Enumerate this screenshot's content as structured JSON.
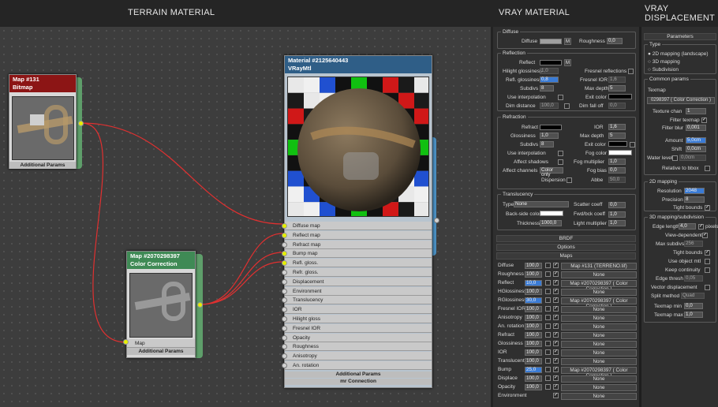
{
  "headers": {
    "terrain": "TERRAIN MATERIAL",
    "vray": "VRAY MATERIAL",
    "disp1": "VRAY",
    "disp2": "DISPLACEMENT"
  },
  "bitmap_node": {
    "title": "Map #131",
    "subtitle": "Bitmap",
    "footer": "Additional Params"
  },
  "cc_node": {
    "title": "Map #2070298397",
    "subtitle": "Color Correction",
    "slot": "Map",
    "footer": "Additional Params"
  },
  "mtl_node": {
    "title": "Material #2125640443",
    "subtitle": "VRayMtl",
    "slots": [
      "Diffuse map",
      "Reflect map",
      "Refract map",
      "Bump map",
      "Refl. gloss.",
      "Refr. gloss.",
      "Displacement",
      "Environment",
      "Translucency",
      "IOR",
      "Hilight gloss",
      "Fresnel IOR",
      "Opacity",
      "Roughness",
      "Anisotropy",
      "An. rotation"
    ],
    "footer1": "Additional Params",
    "footer2": "mr Connection"
  },
  "panel": {
    "diffuse_group": "Diffuse",
    "diffuse": "Diffuse",
    "roughness": "Roughness",
    "roughness_val": "0,0",
    "reflection_group": "Reflection",
    "reflect": "Reflect",
    "hilight": "Hilight glossiness",
    "hilight_val": "1,0",
    "fresnel": "Fresnel reflections",
    "refl_gloss": "Refl. glossiness",
    "refl_gloss_val": "0,8",
    "fresnel_ior": "Fresnel IOR",
    "fresnel_ior_val": "1,6",
    "subdivs": "Subdivs",
    "subdivs_val": "8",
    "max_depth": "Max depth",
    "max_depth_val": "5",
    "use_interp": "Use interpolation",
    "exit_color": "Exit color",
    "dim_dist": "Dim distance",
    "dim_dist_val": "100,0",
    "dim_falloff": "Dim fall off",
    "dim_falloff_val": "0,0",
    "refraction_group": "Refraction",
    "refract": "Refract",
    "ior": "IOR",
    "ior_val": "1,6",
    "gloss": "Glossiness",
    "gloss_val": "1,0",
    "r_max_depth": "Max depth",
    "r_max_depth_val": "5",
    "r_subdivs": "Subdivs",
    "r_subdivs_val": "8",
    "r_exit": "Exit color",
    "r_interp": "Use interpolation",
    "fog_color": "Fog color",
    "affect_shadows": "Affect shadows",
    "fog_mult": "Fog multiplier",
    "fog_mult_val": "1,0",
    "affect_channels": "Affect channels",
    "affect_channels_val": "Color only",
    "fog_bias": "Fog bias",
    "fog_bias_val": "0,0",
    "dispersion": "Dispersion",
    "abbe": "Abbe",
    "abbe_val": "50,0",
    "translucency_group": "Translucency",
    "type": "Type",
    "type_val": "None",
    "scatter": "Scatter coeff",
    "scatter_val": "0,0",
    "backside": "Back-side color",
    "fwd_bck": "Fwd/bck coeff",
    "fwd_bck_val": "1,0",
    "thickness": "Thickness",
    "thickness_val": "1000,0",
    "light_mult": "Light multiplier",
    "light_mult_val": "1,0",
    "brdf": "BRDF",
    "options": "Options",
    "maps": "Maps",
    "map_rows": [
      {
        "name": "Diffuse",
        "amt": "100,0",
        "map": "Map #131 (TERRENO.tif)",
        "blue": false
      },
      {
        "name": "Roughness",
        "amt": "100,0",
        "map": "None",
        "blue": false
      },
      {
        "name": "Reflect",
        "amt": "10,0",
        "map": "Map #2070298397  ( Color Correction )",
        "blue": true
      },
      {
        "name": "HGlossiness",
        "amt": "100,0",
        "map": "None",
        "blue": false
      },
      {
        "name": "RGlossiness",
        "amt": "30,0",
        "map": "Map #2070298397  ( Color Correction )",
        "blue": true
      },
      {
        "name": "Fresnel IOR",
        "amt": "100,0",
        "map": "None",
        "blue": false
      },
      {
        "name": "Anisotropy",
        "amt": "100,0",
        "map": "None",
        "blue": false
      },
      {
        "name": "An. rotation",
        "amt": "100,0",
        "map": "None",
        "blue": false
      },
      {
        "name": "Refract",
        "amt": "100,0",
        "map": "None",
        "blue": false
      },
      {
        "name": "Glossiness",
        "amt": "100,0",
        "map": "None",
        "blue": false
      },
      {
        "name": "IOR",
        "amt": "100,0",
        "map": "None",
        "blue": false
      },
      {
        "name": "Translucent",
        "amt": "100,0",
        "map": "None",
        "blue": false
      },
      {
        "name": "Bump",
        "amt": "25,0",
        "map": "Map #2070298397  ( Color Correction )",
        "blue": true
      },
      {
        "name": "Displace",
        "amt": "100,0",
        "map": "None",
        "blue": false
      },
      {
        "name": "Opacity",
        "amt": "100,0",
        "map": "None",
        "blue": false
      },
      {
        "name": "Environment",
        "amt": "",
        "map": "None",
        "blue": false
      }
    ]
  },
  "disp": {
    "parameters": "Parameters",
    "type": "Type",
    "opt1": "2D mapping (landscape)",
    "opt2": "3D mapping",
    "opt3": "Subdivision",
    "common": "Common params",
    "texmap": "Texmap",
    "texmap_val": "0298397  ( Color Correction )",
    "tex_chan": "Texture chan",
    "tex_chan_val": "1",
    "filter_tex": "Filter texmap",
    "filter_blur": "Filter blur",
    "filter_blur_val": "0,001",
    "amount": "Amount",
    "amount_val": "5,0cm",
    "shift": "Shift",
    "shift_val": "0,0cm",
    "water": "Water level",
    "water_val": "0,0cm",
    "rel_bbox": "Relative to bbox",
    "map2d": "2D mapping",
    "resolution": "Resolution",
    "resolution_val": "2048",
    "precision": "Precision",
    "precision_val": "8",
    "tight": "Tight bounds",
    "map3d": "3D mapping/subdivision",
    "edge_len": "Edge length",
    "edge_len_val": "4,0",
    "pixels": "pixels",
    "view_dep": "View-dependent",
    "max_subdivs": "Max subdivs",
    "max_subdivs_val": "256",
    "tight2": "Tight bounds",
    "use_obj": "Use object mtl",
    "keep_cont": "Keep continuity",
    "edge_thresh": "Edge thresh",
    "edge_thresh_val": "0,05",
    "vector_disp": "Vector displacement",
    "split": "Split method",
    "split_val": "Quad",
    "tex_min": "Texmap min",
    "tex_min_val": "0,0",
    "tex_max": "Texmap max",
    "tex_max_val": "1,0"
  }
}
